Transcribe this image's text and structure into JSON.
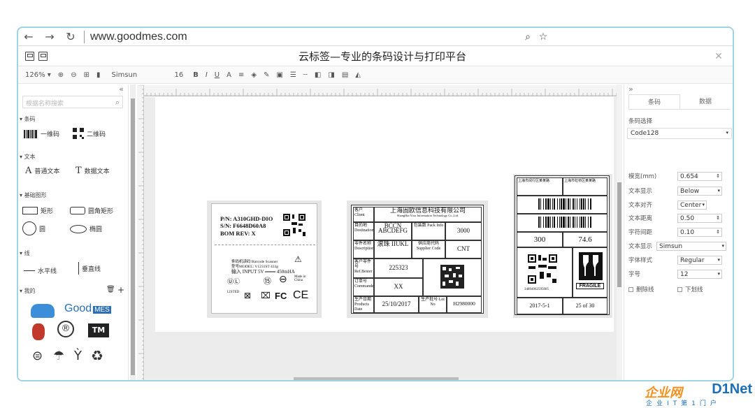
{
  "browser": {
    "url": "www.goodmes.com",
    "back": "←",
    "forward": "→",
    "reload": "↻"
  },
  "app": {
    "title": "云标签—专业的条码设计与打印平台"
  },
  "toolbar": {
    "zoom": "126%",
    "font": "Simsun",
    "size": "16",
    "bold": "B",
    "italic": "I",
    "underline": "U",
    "text": "A"
  },
  "left": {
    "search_placeholder": "根据名称搜索",
    "sections": {
      "barcode": "条码",
      "text": "文本",
      "shapes": "基础图形",
      "line": "线",
      "mine": "我的"
    },
    "items": {
      "barcode1d": "一维码",
      "qrcode": "二维码",
      "plain_text": "普通文本",
      "data_text": "数据文本",
      "rect": "矩形",
      "round_rect": "圆角矩形",
      "circle": "圆",
      "ellipse": "椭圆",
      "hline": "水平线",
      "vline": "垂直线"
    },
    "logo_text": "Good",
    "logo_badge": "MES",
    "tm": "TM",
    "r": "®"
  },
  "right": {
    "tabs": [
      "条码",
      "数据"
    ],
    "section": "条码选择",
    "barcode_type": "Code128",
    "rows": [
      {
        "label": "模宽(mm)",
        "value": "0.654"
      },
      {
        "label": "文本显示",
        "value": "Below"
      },
      {
        "label": "文本对齐",
        "value": "Center"
      },
      {
        "label": "文本距离",
        "value": "0.50"
      },
      {
        "label": "字符间距",
        "value": "0.10"
      },
      {
        "label": "文本显示",
        "value": "Simsun"
      },
      {
        "label": "字体样式",
        "value": "Regular"
      },
      {
        "label": "字号",
        "value": "12"
      }
    ],
    "check_strike": "删除线",
    "check_under": "下划线"
  },
  "label1": {
    "pn": "P/N: A310GHD-DIO",
    "sn": "S/N: F6648D60A8",
    "bom": "BOM REV: X",
    "line1": "条码机读码    Barcode Scanner",
    "line2": "型号MODEL: V1231ST 433g",
    "line3": "输入 INPUT 5V ═══ 450mHA",
    "fc": "FC",
    "ce": "CE",
    "china": "Made in China"
  },
  "label2": {
    "company_cn": "上海固欧信息科技有限公司",
    "company_en": "ShangHai Yixu Information Technology Co.,Ltd.",
    "r1_k": "客户 Client",
    "r2_k": "目的地 Destination",
    "r2_v": "BCCN ABCDEFG",
    "r2_k2": "包装数 Pack Info",
    "r2_v2": "3000",
    "r3_k": "零件名称 Description",
    "r3_v": "滚珠 IIUKL",
    "r3_k2": "供应商代码 Supplier Code",
    "r3_v2": "CNT",
    "r4_k": "客户零件号 Ref.Bester",
    "r4_v": "225323",
    "r5_k": "订单号 Commande",
    "r5_v": "XX",
    "r6_k": "生产日期 Products Date",
    "r6_v": "25/10/2017",
    "r6_k2": "生产批号 Lot No",
    "r6_v2": "H2980000"
  },
  "label3": {
    "from": "上海市闵行区某某路",
    "to": "上海市虹桥区某某路",
    "qty": "300",
    "weight": "74.6",
    "fragile": "FRAGILE",
    "date": "2017-5-1",
    "of": "25 of 30",
    "serial": "34894962595005"
  }
}
